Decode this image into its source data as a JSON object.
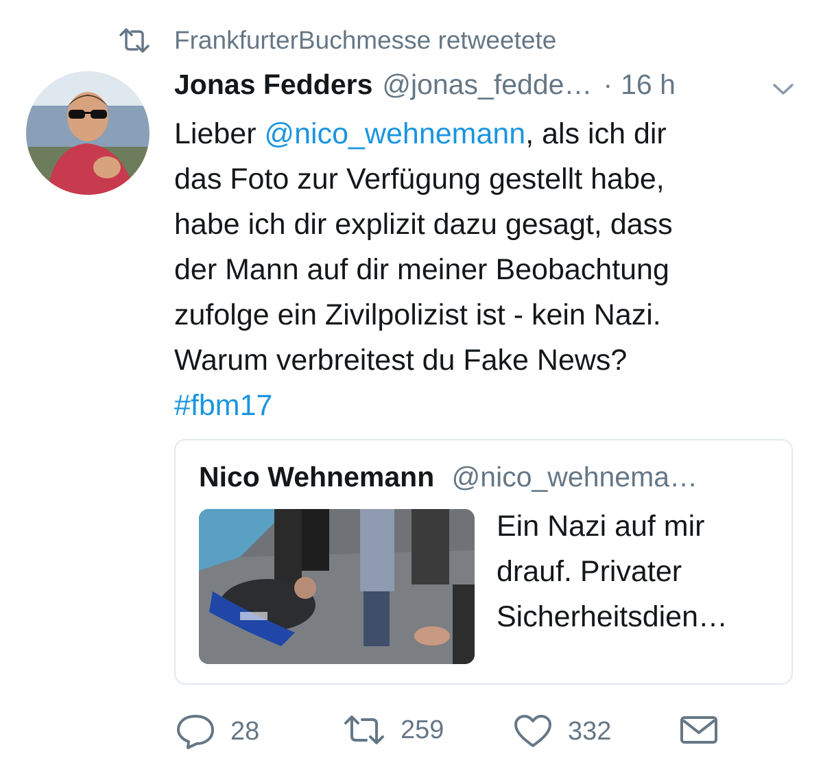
{
  "retweet_banner": {
    "text": "FrankfurterBuchmesse retweetete"
  },
  "tweet": {
    "author_name": "Jonas Fedders",
    "author_handle": "@jonas_fedde…",
    "separator": "·",
    "time": "16 h",
    "text": {
      "l1_pre": "Lieber ",
      "l1_mention": "@nico_wehnemann",
      "l1_post": ", als ich dir",
      "l2": "das Foto zur Verfügung gestellt habe,",
      "l3": "habe ich dir explizit dazu gesagt, dass",
      "l4": "der Mann auf dir meiner Beobachtung",
      "l5": "zufolge ein Zivilpolizist ist - kein Nazi.",
      "l6": "Warum verbreitest du Fake News?",
      "hashtag": "#fbm17"
    }
  },
  "quoted_tweet": {
    "author_name": "Nico Wehnemann",
    "author_handle": "@nico_wehnema…",
    "text_lines": [
      "Ein Nazi auf mir",
      "drauf. Privater",
      "Sicherheitsdien…"
    ]
  },
  "actions": {
    "replies": "28",
    "retweets": "259",
    "likes": "332"
  },
  "colors": {
    "link": "#1b95e0",
    "secondary_text": "#657786",
    "border": "#e1e8ed"
  },
  "icons": [
    "retweet-icon",
    "chevron-down-icon",
    "reply-icon",
    "like-icon",
    "direct-message-icon"
  ]
}
